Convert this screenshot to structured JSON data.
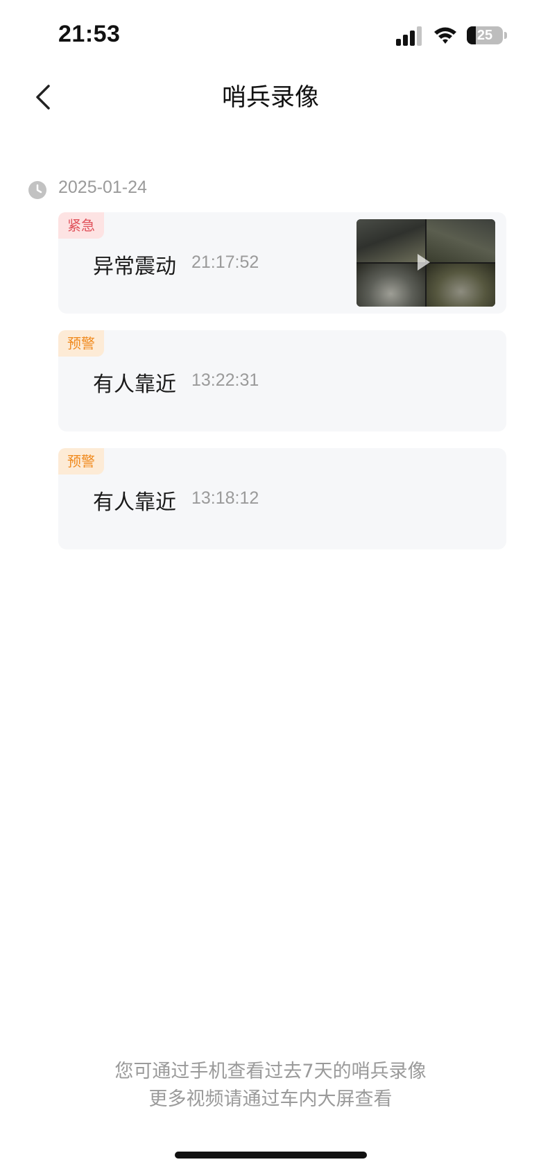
{
  "status_bar": {
    "time": "21:53",
    "battery": "25"
  },
  "nav": {
    "title": "哨兵录像"
  },
  "date_group": {
    "date": "2025-01-24"
  },
  "events": [
    {
      "badge": "紧急",
      "badge_type": "urgent",
      "title": "异常震动",
      "time": "21:17:52",
      "has_thumbnail": true
    },
    {
      "badge": "预警",
      "badge_type": "warning",
      "title": "有人靠近",
      "time": "13:22:31",
      "has_thumbnail": false
    },
    {
      "badge": "预警",
      "badge_type": "warning",
      "title": "有人靠近",
      "time": "13:18:12",
      "has_thumbnail": false
    }
  ],
  "footer": {
    "line1": "您可通过手机查看过去7天的哨兵录像",
    "line2": "更多视频请通过车内大屏查看"
  },
  "colors": {
    "urgent_text": "#e0525b",
    "urgent_bg": "#fde3e3",
    "warning_text": "#f08a1e",
    "warning_bg": "#fdebd6",
    "card_bg": "#f6f7f9"
  }
}
